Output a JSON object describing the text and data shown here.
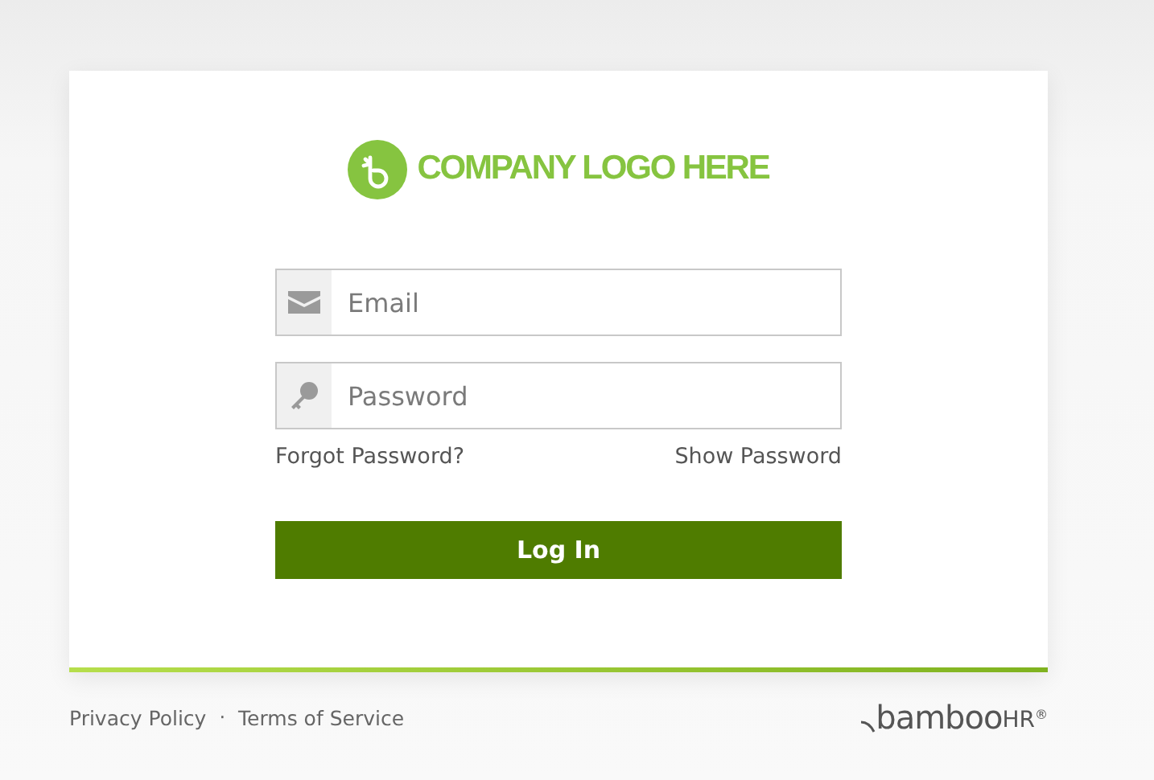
{
  "logo": {
    "text": "COMPANY LOGO HERE"
  },
  "fields": [
    {
      "kind": "email",
      "placeholder": "Email"
    },
    {
      "kind": "password",
      "placeholder": "Password"
    }
  ],
  "links": {
    "forgot": "Forgot Password?",
    "show": "Show Password"
  },
  "button": "Log In",
  "footer": {
    "links": [
      "Privacy Policy",
      "Terms of Service"
    ],
    "separator": "·",
    "brand": {
      "word": "bamboo",
      "suffix": "HR",
      "mark": "®"
    }
  }
}
